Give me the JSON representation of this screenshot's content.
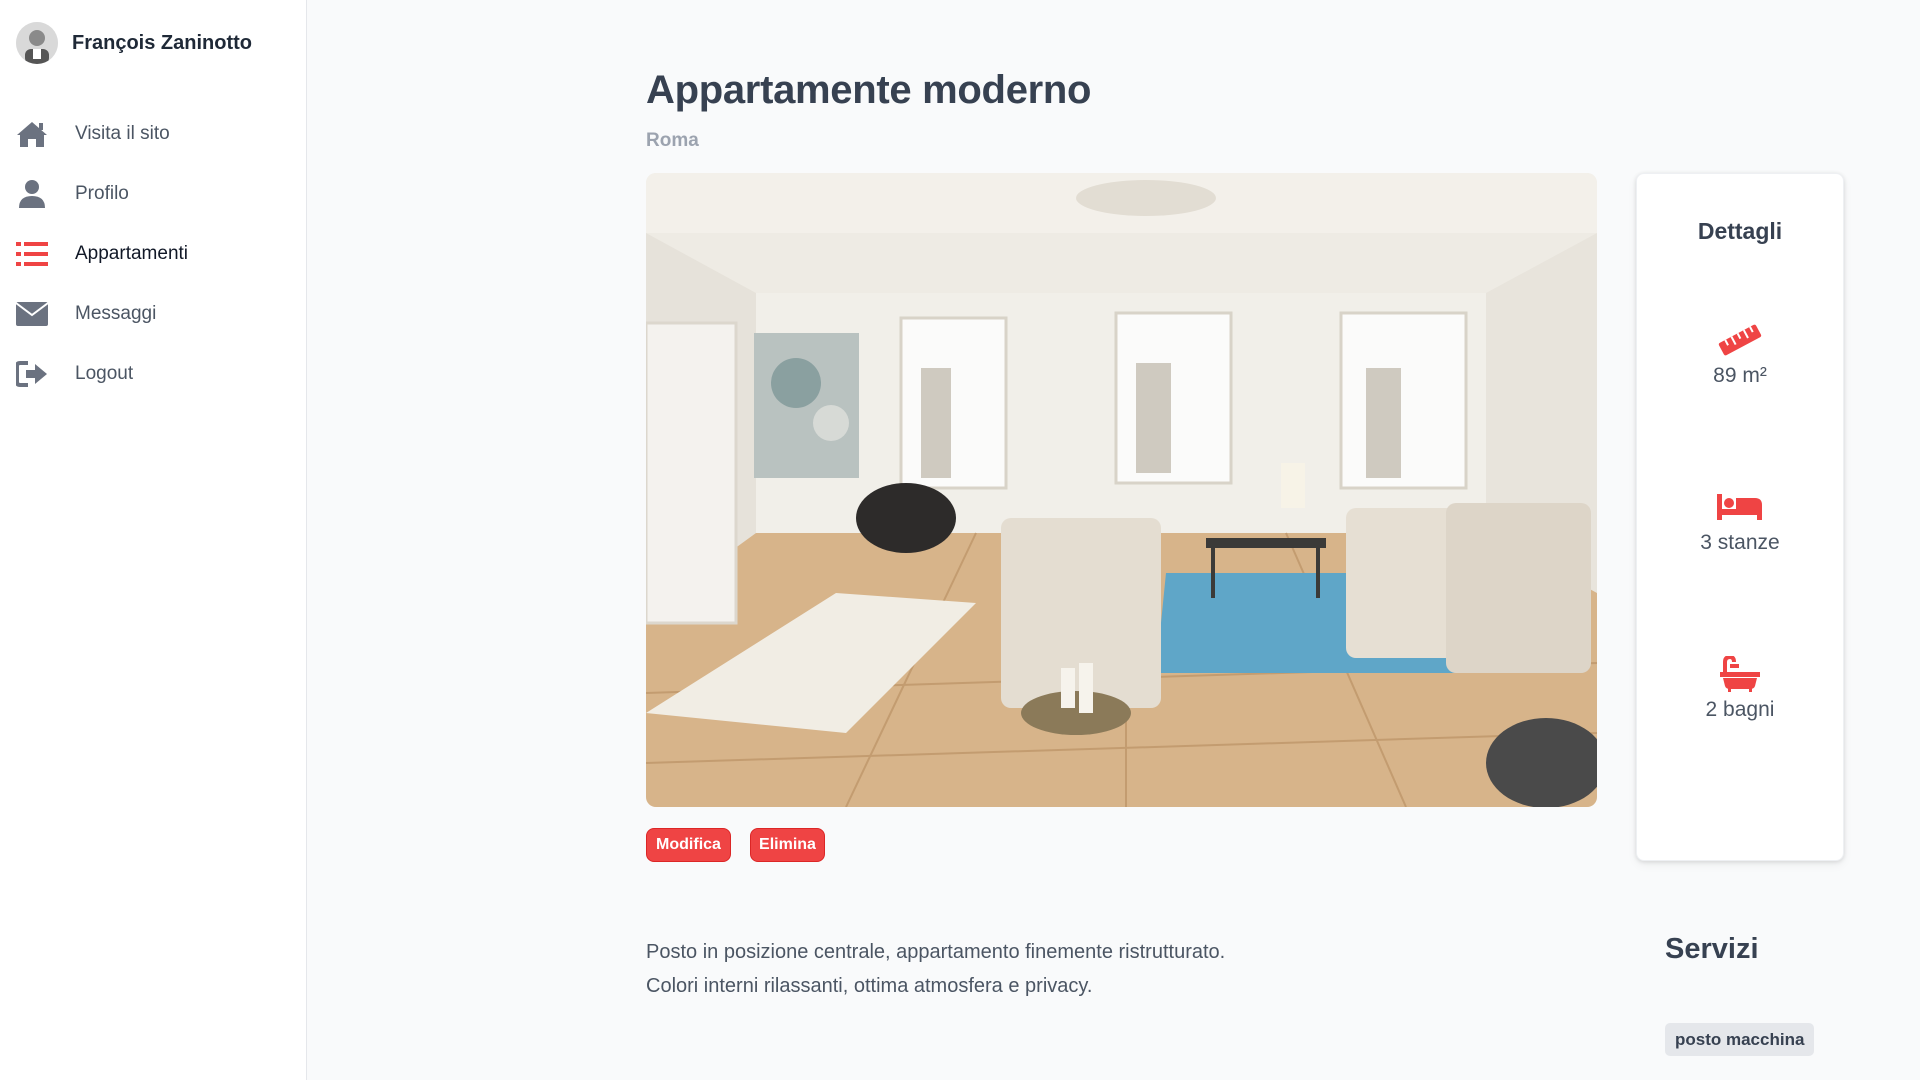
{
  "user": {
    "name": "François Zaninotto"
  },
  "nav": {
    "items": [
      {
        "label": "Visita il sito",
        "icon": "home-icon"
      },
      {
        "label": "Profilo",
        "icon": "user-icon"
      },
      {
        "label": "Appartamenti",
        "icon": "list-icon",
        "active": true
      },
      {
        "label": "Messaggi",
        "icon": "envelope-icon"
      },
      {
        "label": "Logout",
        "icon": "logout-icon"
      }
    ]
  },
  "apartment": {
    "title": "Appartamente moderno",
    "city": "Roma",
    "image": "living-room-photo",
    "actions": {
      "edit_label": "Modifica",
      "delete_label": "Elimina"
    },
    "description": [
      "Posto in posizione centrale, appartamento finemente ristrutturato.",
      "Colori interni rilassanti, ottima atmosfera e privacy."
    ]
  },
  "details": {
    "title": "Dettagli",
    "area": {
      "value": "89 m²",
      "icon": "ruler-icon"
    },
    "rooms": {
      "value": "3 stanze",
      "icon": "bed-icon"
    },
    "bathrooms": {
      "value": "2 bagni",
      "icon": "bath-icon"
    }
  },
  "services": {
    "title": "Servizi",
    "items": [
      "posto macchina"
    ]
  },
  "colors": {
    "accent": "#ef4444",
    "nav_icon": "#6b7280",
    "text": "#374151"
  }
}
